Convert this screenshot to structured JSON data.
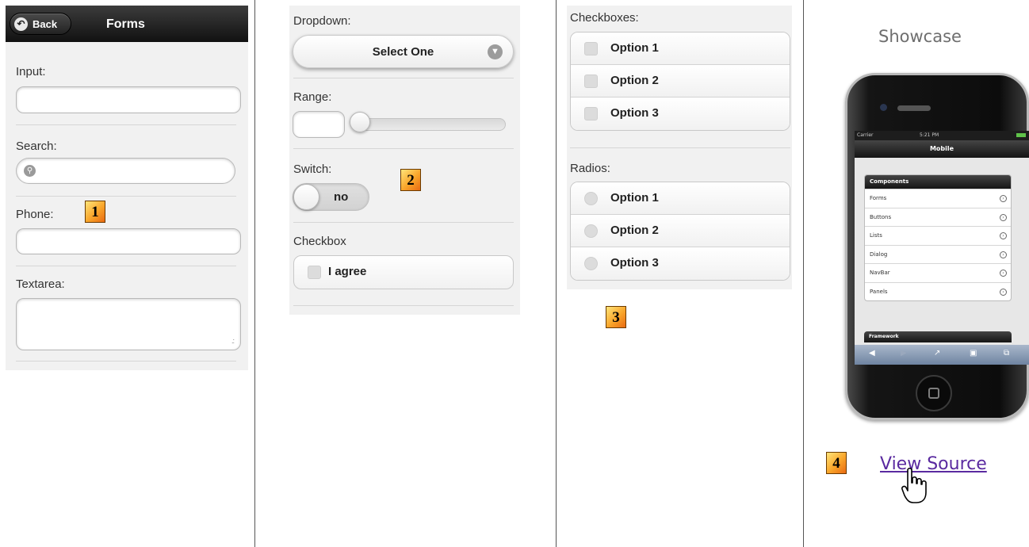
{
  "panel1": {
    "back_label": "Back",
    "title": "Forms",
    "input_label": "Input:",
    "input_value": "",
    "search_label": "Search:",
    "search_value": "",
    "phone_label": "Phone:",
    "phone_value": "",
    "textarea_label": "Textarea:",
    "textarea_value": ""
  },
  "panel2": {
    "dropdown_label": "Dropdown:",
    "dropdown_selected": "Select One",
    "range_label": "Range:",
    "range_value": "",
    "range_position_fraction": 0,
    "switch_label": "Switch:",
    "switch_state": "no",
    "checkbox_label": "Checkbox",
    "checkbox_option": "I agree",
    "checkbox_checked": false
  },
  "panel3": {
    "checkboxes_label": "Checkboxes:",
    "checkbox_options": [
      "Option 1",
      "Option 2",
      "Option 3"
    ],
    "radios_label": "Radios:",
    "radio_options": [
      "Option 1",
      "Option 2",
      "Option 3"
    ]
  },
  "showcase": {
    "title": "Showcase",
    "view_source": "View Source",
    "phone": {
      "carrier": "Carrier",
      "time": "5:21 PM",
      "header": "Mobile",
      "list_header": "Components",
      "items": [
        "Forms",
        "Buttons",
        "Lists",
        "Dialog",
        "NavBar",
        "Panels"
      ],
      "second_header": "Framework"
    }
  },
  "badges": [
    "1",
    "2",
    "3",
    "4"
  ],
  "icons": {
    "back": "back-arrow-icon",
    "search": "search-icon",
    "dropdown": "chevron-down-circle-icon",
    "list_chevron": "chevron-right-circle-icon",
    "cursor": "hand-pointer-icon"
  },
  "colors": {
    "header_bg": "#1a1a1a",
    "panel_bg": "#f1f1f1",
    "link": "#5a2aa0",
    "badge": "#f9a52a"
  }
}
